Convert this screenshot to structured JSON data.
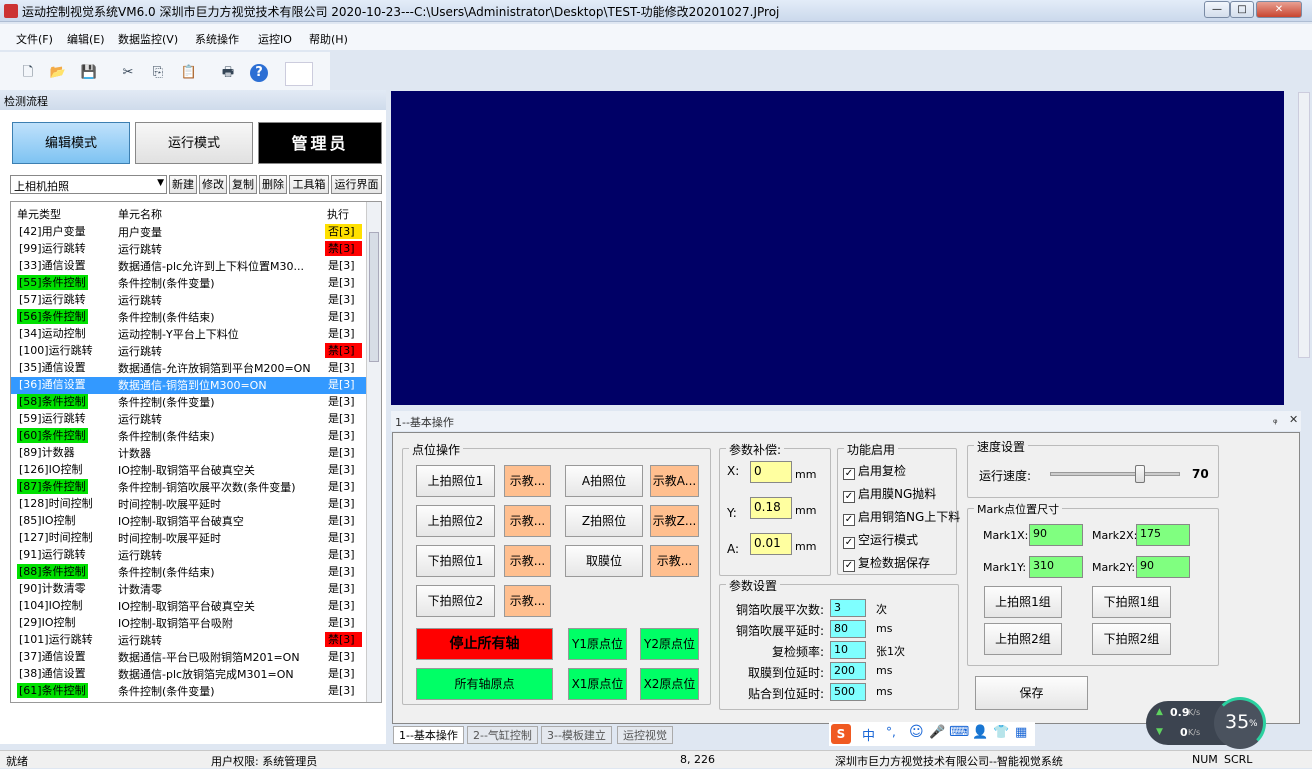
{
  "window": {
    "title": "运动控制视觉系统VM6.0  深圳市巨力方视觉技术有限公司  2020-10-23---C:\\Users\\Administrator\\Desktop\\TEST-功能修改20201027.JProj",
    "btn_min": "—",
    "btn_max": "□",
    "btn_close": "✕"
  },
  "menu": [
    "文件(F)",
    "编辑(E)",
    "数据监控(V)",
    "系统操作",
    "运控IO",
    "帮助(H)"
  ],
  "toolbar": {
    "icons": [
      "new-icon",
      "open-icon",
      "save-icon",
      "cut-icon",
      "copy-icon",
      "paste-icon",
      "print-icon",
      "help-icon"
    ],
    "glyphs": [
      "🗋",
      "📂",
      "💾",
      "✂",
      "⎘",
      "📋",
      "🖶",
      "?"
    ]
  },
  "left": {
    "caption": "检测流程",
    "edit_mode": "编辑模式",
    "run_mode": "运行模式",
    "admin": "管理员",
    "combo": "上相机拍照",
    "combo_arrow": "▼",
    "buttons": [
      "新建",
      "修改",
      "复制",
      "删除",
      "工具箱",
      "运行界面"
    ],
    "headers": [
      "单元类型",
      "单元名称",
      "执行"
    ],
    "rows": [
      {
        "type": "[42]用户变量",
        "name": "用户变量",
        "exec": "否[3]",
        "tc": "",
        "ec": "y"
      },
      {
        "type": "[99]运行跳转",
        "name": "运行跳转",
        "exec": "禁[3]",
        "tc": "",
        "ec": "r"
      },
      {
        "type": "[33]通信设置",
        "name": "数据通信-plc允许到上下料位置M30...",
        "exec": "是[3]",
        "tc": "",
        "ec": ""
      },
      {
        "type": "[55]条件控制",
        "name": "条件控制(条件变量)",
        "exec": "是[3]",
        "tc": "g",
        "ec": ""
      },
      {
        "type": "[57]运行跳转",
        "name": "运行跳转",
        "exec": "是[3]",
        "tc": "",
        "ec": ""
      },
      {
        "type": "[56]条件控制",
        "name": "条件控制(条件结束)",
        "exec": "是[3]",
        "tc": "g",
        "ec": ""
      },
      {
        "type": "[34]运动控制",
        "name": "运动控制-Y平台上下料位",
        "exec": "是[3]",
        "tc": "",
        "ec": ""
      },
      {
        "type": "[100]运行跳转",
        "name": "运行跳转",
        "exec": "禁[3]",
        "tc": "",
        "ec": "r"
      },
      {
        "type": "[35]通信设置",
        "name": "数据通信-允许放铜箔到平台M200=ON",
        "exec": "是[3]",
        "tc": "",
        "ec": ""
      },
      {
        "type": "[36]通信设置",
        "name": "数据通信-铜箔到位M300=ON",
        "exec": "是[3]",
        "tc": "",
        "ec": "",
        "sel": true
      },
      {
        "type": "[58]条件控制",
        "name": "条件控制(条件变量)",
        "exec": "是[3]",
        "tc": "g",
        "ec": ""
      },
      {
        "type": "[59]运行跳转",
        "name": "运行跳转",
        "exec": "是[3]",
        "tc": "",
        "ec": ""
      },
      {
        "type": "[60]条件控制",
        "name": "条件控制(条件结束)",
        "exec": "是[3]",
        "tc": "g",
        "ec": ""
      },
      {
        "type": "[89]计数器",
        "name": "计数器",
        "exec": "是[3]",
        "tc": "",
        "ec": ""
      },
      {
        "type": "[126]IO控制",
        "name": "IO控制-取铜箔平台破真空关",
        "exec": "是[3]",
        "tc": "",
        "ec": ""
      },
      {
        "type": "[87]条件控制",
        "name": "条件控制-铜箔吹展平次数(条件变量)",
        "exec": "是[3]",
        "tc": "g",
        "ec": ""
      },
      {
        "type": "[128]时间控制",
        "name": "时间控制-吹展平延时",
        "exec": "是[3]",
        "tc": "",
        "ec": ""
      },
      {
        "type": "[85]IO控制",
        "name": "IO控制-取铜箔平台破真空",
        "exec": "是[3]",
        "tc": "",
        "ec": ""
      },
      {
        "type": "[127]时间控制",
        "name": "时间控制-吹展平延时",
        "exec": "是[3]",
        "tc": "",
        "ec": ""
      },
      {
        "type": "[91]运行跳转",
        "name": "运行跳转",
        "exec": "是[3]",
        "tc": "",
        "ec": ""
      },
      {
        "type": "[88]条件控制",
        "name": "条件控制(条件结束)",
        "exec": "是[3]",
        "tc": "g",
        "ec": ""
      },
      {
        "type": "[90]计数清零",
        "name": "计数清零",
        "exec": "是[3]",
        "tc": "",
        "ec": ""
      },
      {
        "type": "[104]IO控制",
        "name": "IO控制-取铜箔平台破真空关",
        "exec": "是[3]",
        "tc": "",
        "ec": ""
      },
      {
        "type": "[29]IO控制",
        "name": "IO控制-取铜箔平台吸附",
        "exec": "是[3]",
        "tc": "",
        "ec": ""
      },
      {
        "type": "[101]运行跳转",
        "name": "运行跳转",
        "exec": "禁[3]",
        "tc": "",
        "ec": "r"
      },
      {
        "type": "[37]通信设置",
        "name": "数据通信-平台已吸附铜箔M201=ON",
        "exec": "是[3]",
        "tc": "",
        "ec": ""
      },
      {
        "type": "[38]通信设置",
        "name": "数据通信-plc放铜箔完成M301=ON",
        "exec": "是[3]",
        "tc": "",
        "ec": ""
      },
      {
        "type": "[61]条件控制",
        "name": "条件控制(条件变量)",
        "exec": "是[3]",
        "tc": "g",
        "ec": ""
      }
    ]
  },
  "bottom": {
    "caption": "1--基本操作",
    "pin": "ᵩ",
    "close": "✕",
    "point_group": "点位操作",
    "btn_up1": "上拍照位1",
    "btn_up2": "上拍照位2",
    "btn_dn1": "下拍照位1",
    "btn_dn2": "下拍照位2",
    "teach": "示教...",
    "btn_a": "A拍照位",
    "teach_a": "示教A...",
    "btn_z": "Z拍照位",
    "teach_z": "示教Z...",
    "btn_film": "取膜位",
    "stop_all": "停止所有轴",
    "home_all": "所有轴原点",
    "y1": "Y1原点位",
    "y2": "Y2原点位",
    "x1": "X1原点位",
    "x2": "X2原点位",
    "comp_group": "参数补偿:",
    "x_lbl": "X:",
    "x_val": "0",
    "y_lbl": "Y:",
    "y_val": "0.18",
    "a_lbl": "A:",
    "a_val": "0.01",
    "mm": "mm",
    "func_group": "功能启用",
    "checks": [
      "启用复检",
      "启用膜NG抛料",
      "启用铜箔NG上下料",
      "空运行模式",
      "复检数据保存"
    ],
    "check_mark": "✓",
    "param_group": "参数设置",
    "params": [
      {
        "label": "铜箔吹展平次数:",
        "val": "3",
        "unit": "次"
      },
      {
        "label": "铜箔吹展平延时:",
        "val": "80",
        "unit": "ms"
      },
      {
        "label": "复检频率:",
        "val": "10",
        "unit": "张1次"
      },
      {
        "label": "取膜到位延时:",
        "val": "200",
        "unit": "ms"
      },
      {
        "label": "贴合到位延时:",
        "val": "500",
        "unit": "ms"
      }
    ],
    "speed_group": "速度设置",
    "speed_label": "运行速度:",
    "speed_value": "70",
    "speed_fraction": 0.7,
    "mark_group": "Mark点位置尺寸",
    "mark1x_lbl": "Mark1X:",
    "mark1x": "90",
    "mark2x_lbl": "Mark2X:",
    "mark2x": "175",
    "mark1y_lbl": "Mark1Y:",
    "mark1y": "310",
    "mark2y_lbl": "Mark2Y:",
    "mark2y": "90",
    "up_g1": "上拍照1组",
    "dn_g1": "下拍照1组",
    "up_g2": "上拍照2组",
    "dn_g2": "下拍照2组",
    "save": "保存"
  },
  "tabs": [
    "1--基本操作",
    "2--气缸控制",
    "3--模板建立",
    "运控视觉"
  ],
  "ime": {
    "logo": "S",
    "chars": [
      "中",
      "°,",
      "☺",
      "🎤",
      "⌨",
      "👤",
      "👕",
      "▦"
    ]
  },
  "net": {
    "up": "0.9",
    "up_unit": "K/s",
    "down": "0",
    "down_unit": "K/s",
    "percent": "35",
    "pct_sign": "%"
  },
  "status": {
    "ready": "就绪",
    "user": "用户权限: 系统管理员",
    "coords": "8, 226",
    "company": "深圳市巨力方视觉技术有限公司--智能视觉系统",
    "num": "NUM",
    "scrl": "SCRL"
  }
}
